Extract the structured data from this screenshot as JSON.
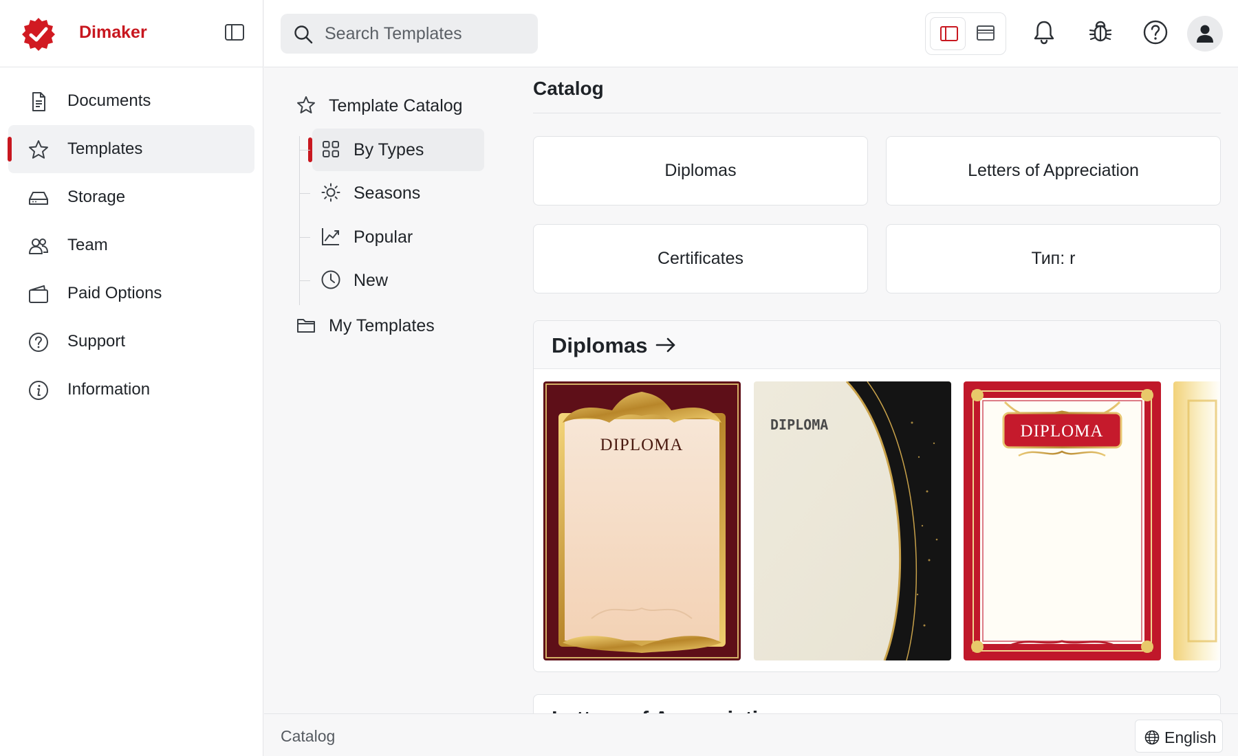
{
  "brand": {
    "name": "Dimaker",
    "accent": "#c8171f"
  },
  "sidebar": {
    "items": [
      {
        "label": "Documents",
        "icon": "document-icon"
      },
      {
        "label": "Templates",
        "icon": "star-icon",
        "active": true
      },
      {
        "label": "Storage",
        "icon": "storage-icon"
      },
      {
        "label": "Team",
        "icon": "team-icon"
      },
      {
        "label": "Paid Options",
        "icon": "wallet-icon"
      },
      {
        "label": "Support",
        "icon": "question-icon"
      },
      {
        "label": "Information",
        "icon": "info-icon"
      }
    ]
  },
  "search": {
    "placeholder": "Search Templates",
    "value": ""
  },
  "header": {
    "icons": [
      "panel-view-icon",
      "window-view-icon",
      "bell-icon",
      "bug-icon",
      "help-icon",
      "user-icon"
    ]
  },
  "tree": {
    "root": "Template Catalog",
    "children": [
      {
        "label": "By Types",
        "icon": "grid-icon",
        "active": true
      },
      {
        "label": "Seasons",
        "icon": "sun-icon"
      },
      {
        "label": "Popular",
        "icon": "trend-icon"
      },
      {
        "label": "New",
        "icon": "clock-icon"
      }
    ],
    "my_templates": "My Templates"
  },
  "main": {
    "title": "Catalog",
    "categories": [
      "Diplomas",
      "Letters of Appreciation",
      "Certificates",
      "Тип: r"
    ],
    "sections": [
      {
        "title": "Diplomas",
        "thumbnails": [
          {
            "label": "DIPLOMA",
            "style": "burgundy-gold"
          },
          {
            "label": "DIPLOMA",
            "style": "cream-black-wave"
          },
          {
            "label": "DIPLOMA",
            "style": "red-ornate"
          },
          {
            "label": "",
            "style": "gold-partial"
          }
        ]
      },
      {
        "title": "Letters of Appreciation"
      }
    ]
  },
  "status": {
    "text": "Catalog",
    "language": "English"
  }
}
